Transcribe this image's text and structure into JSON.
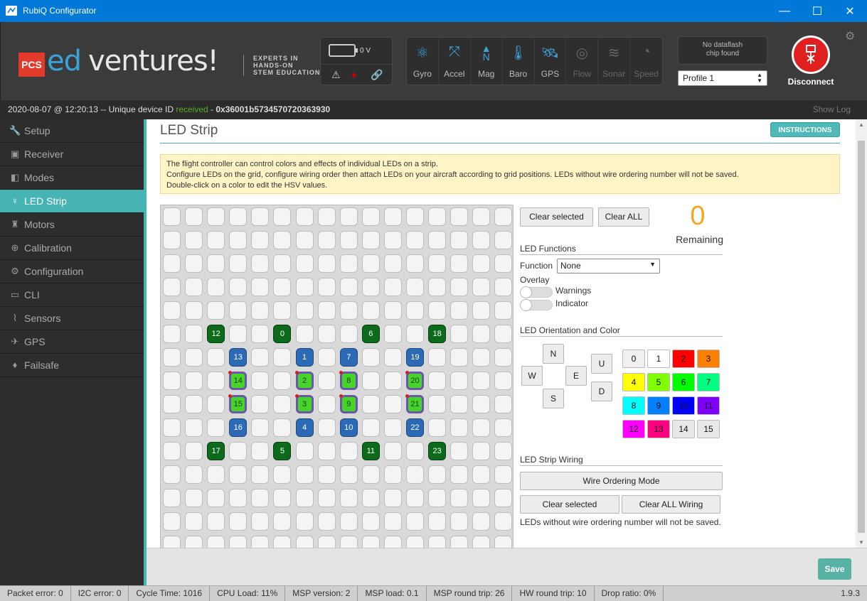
{
  "window": {
    "title": "RubiQ Configurator",
    "controls": [
      "—",
      "☐",
      "✕"
    ]
  },
  "logo": {
    "badge": "PCS",
    "ed": "ed",
    "ventures": "ventures!",
    "tag1": "EXPERTS IN",
    "tag2": "HANDS-ON",
    "tag3": "STEM EDUCATION"
  },
  "battery": {
    "voltage": "0 V"
  },
  "sensors": [
    {
      "label": "Gyro",
      "icon": "gyro-icon",
      "active": true
    },
    {
      "label": "Accel",
      "icon": "accel-icon",
      "active": true
    },
    {
      "label": "Mag",
      "icon": "mag-icon",
      "active": true
    },
    {
      "label": "Baro",
      "icon": "baro-icon",
      "active": true
    },
    {
      "label": "GPS",
      "icon": "gps-icon",
      "active": true
    },
    {
      "label": "Flow",
      "icon": "flow-icon",
      "active": false
    },
    {
      "label": "Sonar",
      "icon": "sonar-icon",
      "active": false
    },
    {
      "label": "Speed",
      "icon": "speed-icon",
      "active": false
    }
  ],
  "dataflash": {
    "line1": "No dataflash",
    "line2": "chip found"
  },
  "profile": {
    "selected": "Profile 1"
  },
  "connect": {
    "label": "Disconnect"
  },
  "log": {
    "prefix": "2020-08-07 @ 12:20:13 -- Unique device ID ",
    "status": "received",
    "device_id": "0x36001b5734570720363930",
    "show_log": "Show Log"
  },
  "sidebar": {
    "items": [
      {
        "label": "Setup",
        "icon": "wrench-icon",
        "active": false
      },
      {
        "label": "Receiver",
        "icon": "receiver-icon",
        "active": false
      },
      {
        "label": "Modes",
        "icon": "modes-icon",
        "active": false
      },
      {
        "label": "LED Strip",
        "icon": "led-icon",
        "active": true
      },
      {
        "label": "Motors",
        "icon": "motor-icon",
        "active": false
      },
      {
        "label": "Calibration",
        "icon": "calibration-icon",
        "active": false
      },
      {
        "label": "Configuration",
        "icon": "gear-icon",
        "active": false
      },
      {
        "label": "CLI",
        "icon": "cli-icon",
        "active": false
      },
      {
        "label": "Sensors",
        "icon": "sensors-icon",
        "active": false
      },
      {
        "label": "GPS",
        "icon": "gps-icon",
        "active": false
      },
      {
        "label": "Failsafe",
        "icon": "parachute-icon",
        "active": false
      }
    ]
  },
  "page": {
    "title": "LED Strip",
    "instructions": "INSTRUCTIONS",
    "note_lines": [
      "The flight controller can control colors and effects of individual LEDs on a strip.",
      "Configure LEDs on the grid, configure wiring order then attach LEDs on your aircraft according to grid positions. LEDs without wire ordering number will not be saved.",
      "Double-click on a color to edit the HSV values."
    ]
  },
  "grid": {
    "rows": 15,
    "cols": 16,
    "leds": [
      {
        "row": 5,
        "col": 2,
        "n": "12",
        "style": "dgreen"
      },
      {
        "row": 5,
        "col": 5,
        "n": "0",
        "style": "dgreen"
      },
      {
        "row": 5,
        "col": 9,
        "n": "6",
        "style": "dgreen"
      },
      {
        "row": 5,
        "col": 12,
        "n": "18",
        "style": "dgreen"
      },
      {
        "row": 6,
        "col": 3,
        "n": "13",
        "style": "blue"
      },
      {
        "row": 6,
        "col": 6,
        "n": "1",
        "style": "blue"
      },
      {
        "row": 6,
        "col": 8,
        "n": "7",
        "style": "blue"
      },
      {
        "row": 6,
        "col": 11,
        "n": "19",
        "style": "blue"
      },
      {
        "row": 7,
        "col": 3,
        "n": "14",
        "style": "lgreen"
      },
      {
        "row": 7,
        "col": 6,
        "n": "2",
        "style": "lgreen"
      },
      {
        "row": 7,
        "col": 8,
        "n": "8",
        "style": "lgreen"
      },
      {
        "row": 7,
        "col": 11,
        "n": "20",
        "style": "lgreen"
      },
      {
        "row": 8,
        "col": 3,
        "n": "15",
        "style": "lgreen"
      },
      {
        "row": 8,
        "col": 6,
        "n": "3",
        "style": "lgreen"
      },
      {
        "row": 8,
        "col": 8,
        "n": "9",
        "style": "lgreen"
      },
      {
        "row": 8,
        "col": 11,
        "n": "21",
        "style": "lgreen"
      },
      {
        "row": 9,
        "col": 3,
        "n": "16",
        "style": "blue"
      },
      {
        "row": 9,
        "col": 6,
        "n": "4",
        "style": "blue"
      },
      {
        "row": 9,
        "col": 8,
        "n": "10",
        "style": "blue"
      },
      {
        "row": 9,
        "col": 11,
        "n": "22",
        "style": "blue"
      },
      {
        "row": 10,
        "col": 2,
        "n": "17",
        "style": "dgreen"
      },
      {
        "row": 10,
        "col": 5,
        "n": "5",
        "style": "dgreen"
      },
      {
        "row": 10,
        "col": 9,
        "n": "11",
        "style": "dgreen"
      },
      {
        "row": 10,
        "col": 12,
        "n": "23",
        "style": "dgreen"
      }
    ]
  },
  "controls": {
    "clear_selected": "Clear selected",
    "clear_all": "Clear ALL",
    "remaining_count": "0",
    "remaining_label": "Remaining",
    "functions_title": "LED Functions",
    "function_label": "Function",
    "function_value": "None",
    "overlay_label": "Overlay",
    "warnings_label": "Warnings",
    "indicator_label": "Indicator",
    "orientation_title": "LED Orientation and Color",
    "directions": {
      "n": "N",
      "w": "W",
      "e": "E",
      "s": "S",
      "u": "U",
      "d": "D"
    },
    "colors": [
      {
        "n": "0",
        "hex": "#f0f0f0"
      },
      {
        "n": "1",
        "hex": "#ffffff"
      },
      {
        "n": "2",
        "hex": "#ff0000"
      },
      {
        "n": "3",
        "hex": "#ff8000"
      },
      {
        "n": "4",
        "hex": "#ffff00"
      },
      {
        "n": "5",
        "hex": "#80ff00"
      },
      {
        "n": "6",
        "hex": "#00ff00"
      },
      {
        "n": "7",
        "hex": "#00ff80"
      },
      {
        "n": "8",
        "hex": "#00ffff"
      },
      {
        "n": "9",
        "hex": "#0080ff"
      },
      {
        "n": "10",
        "hex": "#0000ff"
      },
      {
        "n": "11",
        "hex": "#8000ff"
      },
      {
        "n": "12",
        "hex": "#ff00ff"
      },
      {
        "n": "13",
        "hex": "#ff0080"
      },
      {
        "n": "14",
        "hex": "#e8e8e8"
      },
      {
        "n": "15",
        "hex": "#e8e8e8"
      }
    ],
    "wiring_title": "LED Strip Wiring",
    "wire_ordering_mode": "Wire Ordering Mode",
    "wire_clear_selected": "Clear selected",
    "wire_clear_all": "Clear ALL Wiring",
    "wire_note": "LEDs without wire ordering number will not be saved."
  },
  "save": {
    "label": "Save"
  },
  "status": {
    "items": [
      "Packet error: 0",
      "I2C error: 0",
      "Cycle Time: 1016",
      "CPU Load: 11%",
      "MSP version: 2",
      "MSP load: 0.1",
      "MSP round trip: 26",
      "HW round trip: 10",
      "Drop ratio: 0%"
    ],
    "version": "1.9.3"
  },
  "colors": {
    "titlebar": "#0078d7",
    "accent": "#47b4b4",
    "received": "#59aa29",
    "remaining": "#f5a623",
    "disconnect": "#e0201f"
  }
}
